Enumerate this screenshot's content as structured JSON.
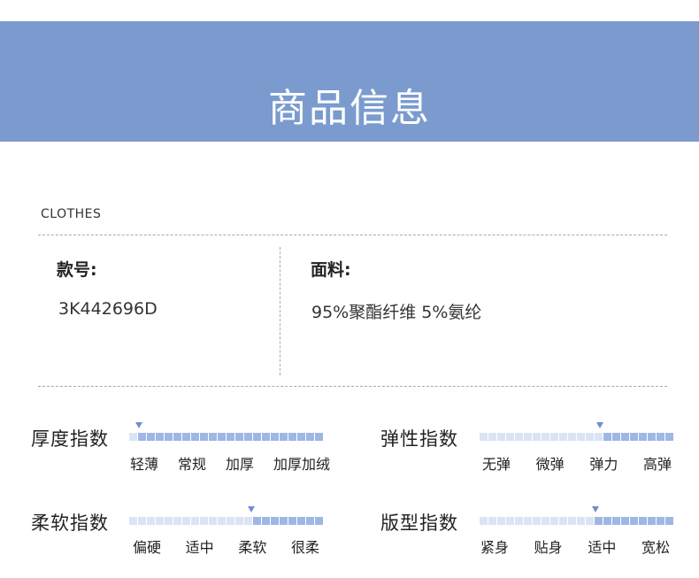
{
  "header": {
    "title": "商品信息"
  },
  "category": "CLOTHES",
  "fields": {
    "style_no_label": "款号:",
    "style_no_value": "3K442696D",
    "fabric_label": "面料:",
    "fabric_value": "95%聚酯纤维 5%氨纶"
  },
  "indices": [
    {
      "label": "厚度指数",
      "options": [
        "轻薄",
        "常规",
        "加厚",
        "加厚加绒"
      ],
      "level": 0.05
    },
    {
      "label": "弹性指数",
      "options": [
        "无弹",
        "微弹",
        "弹力",
        "高弹"
      ],
      "level": 0.62
    },
    {
      "label": "柔软指数",
      "options": [
        "偏硬",
        "适中",
        "柔软",
        "很柔"
      ],
      "level": 0.63
    },
    {
      "label": "版型指数",
      "options": [
        "紧身",
        "贴身",
        "适中",
        "宽松"
      ],
      "level": 0.6
    }
  ],
  "colors": {
    "banner": "#7b9bcf",
    "bar_light": "#dbe4f4",
    "bar_dark": "#9fb7e4",
    "marker": "#6f8fd2"
  }
}
